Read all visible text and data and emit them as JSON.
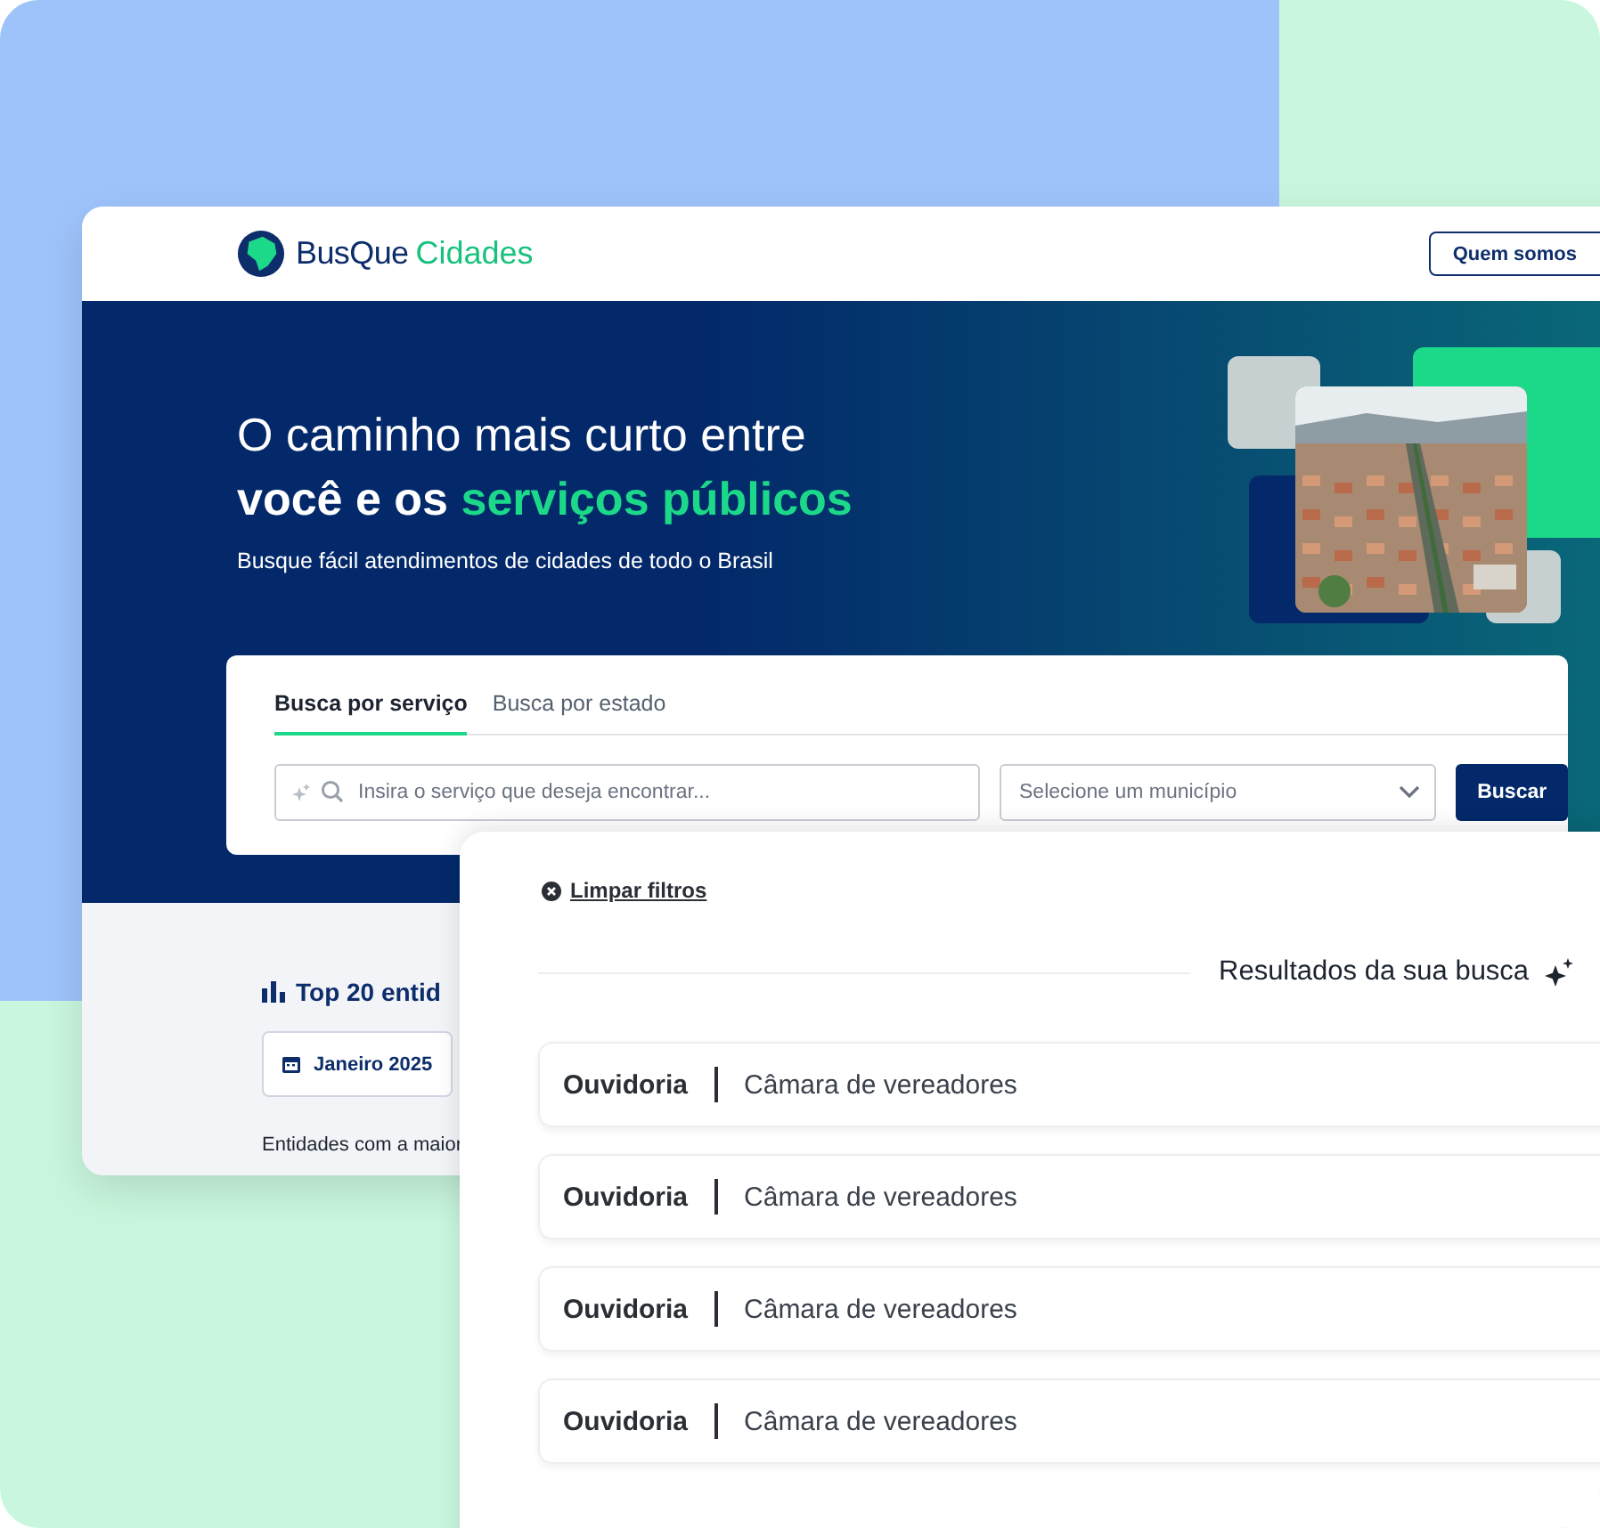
{
  "header": {
    "logo": {
      "brand_first": "BusQue",
      "brand_second": "Cidades"
    },
    "nav_button": "Quem somos"
  },
  "hero": {
    "title_line1": "O caminho mais curto entre",
    "title_line2_start": "você e os",
    "title_line2_highlight": "serviços públicos",
    "subtitle": "Busque fácil atendimentos de cidades de todo o Brasil"
  },
  "search": {
    "tabs": [
      {
        "label": "Busca por serviço",
        "selected": true
      },
      {
        "label": "Busca por estado",
        "selected": false
      }
    ],
    "service_field": {
      "placeholder": "Insira o serviço que deseja encontrar..."
    },
    "city_select": {
      "placeholder": "Selecione um município"
    },
    "submit": "Buscar"
  },
  "ranking": {
    "title": "Top 20 entid",
    "month_button": "Janeiro 2025",
    "caption": "Entidades com a maior"
  },
  "results_panel": {
    "clear_filters": "Limpar filtros",
    "heading": "Resultados da sua busca",
    "results": [
      {
        "service": "Ouvidoria",
        "entity": "Câmara de vereadores"
      },
      {
        "service": "Ouvidoria",
        "entity": "Câmara de vereadores"
      },
      {
        "service": "Ouvidoria",
        "entity": "Câmara de vereadores"
      },
      {
        "service": "Ouvidoria",
        "entity": "Câmara de vereadores"
      }
    ]
  }
}
